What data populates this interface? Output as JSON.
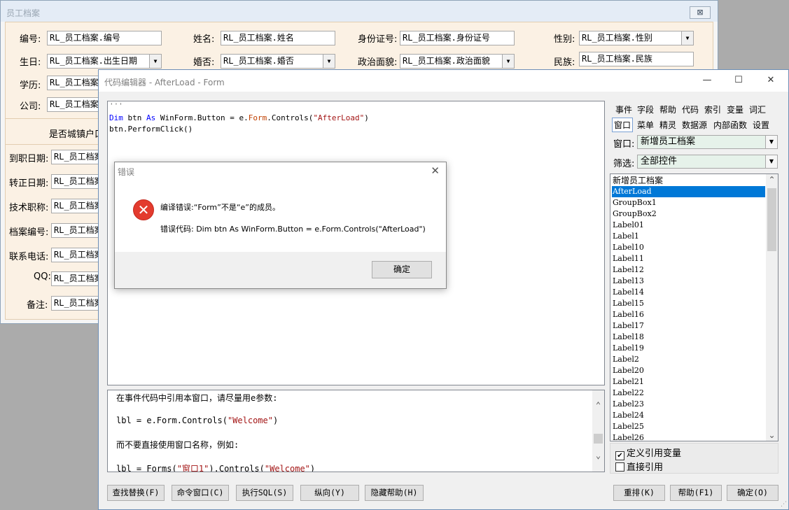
{
  "background_window": {
    "title": "员工档案",
    "close_label": "⊠",
    "fields": [
      {
        "label": "编号:",
        "value": "RL_员工档案.编号"
      },
      {
        "label": "姓名:",
        "value": "RL_员工档案.姓名"
      },
      {
        "label": "身份证号:",
        "value": "RL_员工档案.身份证号"
      },
      {
        "label": "性别:",
        "value": "RL_员工档案.性别"
      },
      {
        "label": "生日:",
        "value": "RL_员工档案.出生日期"
      },
      {
        "label": "婚否:",
        "value": "RL_员工档案.婚否"
      },
      {
        "label": "政治面貌:",
        "value": "RL_员工档案.政治面貌"
      },
      {
        "label": "民族:",
        "value": "RL_员工档案.民族"
      },
      {
        "label": "学历:",
        "value": "RL_员工档案."
      },
      {
        "label": "公司:",
        "value": "RL_员工档案."
      }
    ],
    "checkbox_label": "是否城镇户口",
    "lower_fields": [
      {
        "label": "到职日期:",
        "value": "RL_员工档案."
      },
      {
        "label": "转正日期:",
        "value": "RL_员工档案."
      },
      {
        "label": "技术职称:",
        "value": "RL_员工档案."
      },
      {
        "label": "档案编号:",
        "value": "RL_员工档案."
      },
      {
        "label": "联系电话:",
        "value": "RL_员工档案."
      },
      {
        "label": "QQ:",
        "value": "RL_员工档案."
      },
      {
        "label": "备注:",
        "value": "RL_员工档案."
      }
    ]
  },
  "editor": {
    "title": "代码编辑器 - AfterLoad - Form",
    "window_buttons": {
      "minimize": "—",
      "maximize": "☐",
      "close": "✕"
    },
    "code_lines": {
      "l0": "'''",
      "l1_kw1": "Dim",
      "l1_a": " btn ",
      "l1_kw2": "As",
      "l1_b": " WinForm.Button = e.",
      "l1_form": "Form",
      "l1_c": ".Controls(",
      "l1_str": "\"AfterLoad\"",
      "l1_d": ")",
      "l2": "btn.PerformClick()"
    },
    "help_lines": {
      "h1": "在事件代码中引用本窗口，请尽量用e参数:",
      "h2a": "lbl = e.Form.Controls(",
      "h2s": "\"Welcome\"",
      "h2b": ")",
      "h3": "而不要直接使用窗口名称，例如:",
      "h4a": "lbl = Forms(",
      "h4s1": "\"窗口1\"",
      "h4b": ").Controls(",
      "h4s2": "\"Welcome\"",
      "h4c": ")"
    },
    "tabs_row1": [
      "事件",
      "字段",
      "帮助",
      "代码",
      "索引",
      "变量",
      "词汇"
    ],
    "tabs_row2": [
      "窗口",
      "菜单",
      "精灵",
      "数据源",
      "内部函数",
      "设置"
    ],
    "window_label": "窗口:",
    "window_value": "新增员工档案",
    "filter_label": "筛选:",
    "filter_value": "全部控件",
    "control_list": [
      "新增员工档案",
      "AfterLoad",
      "GroupBox1",
      "GroupBox2",
      "Label01",
      "Label1",
      "Label10",
      "Label11",
      "Label12",
      "Label13",
      "Label14",
      "Label15",
      "Label16",
      "Label17",
      "Label18",
      "Label19",
      "Label2",
      "Label20",
      "Label21",
      "Label22",
      "Label23",
      "Label24",
      "Label25",
      "Label26"
    ],
    "selected_item": "AfterLoad",
    "check_define": "定义引用变量",
    "check_direct": "直接引用",
    "check_define_checked": "✔",
    "buttons": {
      "find": "查找替换(F)",
      "cmd": "命令窗口(C)",
      "sql": "执行SQL(S)",
      "vertical": "纵向(Y)",
      "hide_help": "隐藏帮助(H)",
      "rearrange": "重排(K)",
      "help": "帮助(F1)",
      "ok": "确定(O)"
    }
  },
  "error_dialog": {
    "title": "错误",
    "close": "✕",
    "icon": "✕",
    "message": "编译错误:“Form”不是“e”的成员。",
    "detail": "错误代码: Dim btn As WinForm.Button = e.Form.Controls(\"AfterLoad\")",
    "ok": "确定"
  }
}
